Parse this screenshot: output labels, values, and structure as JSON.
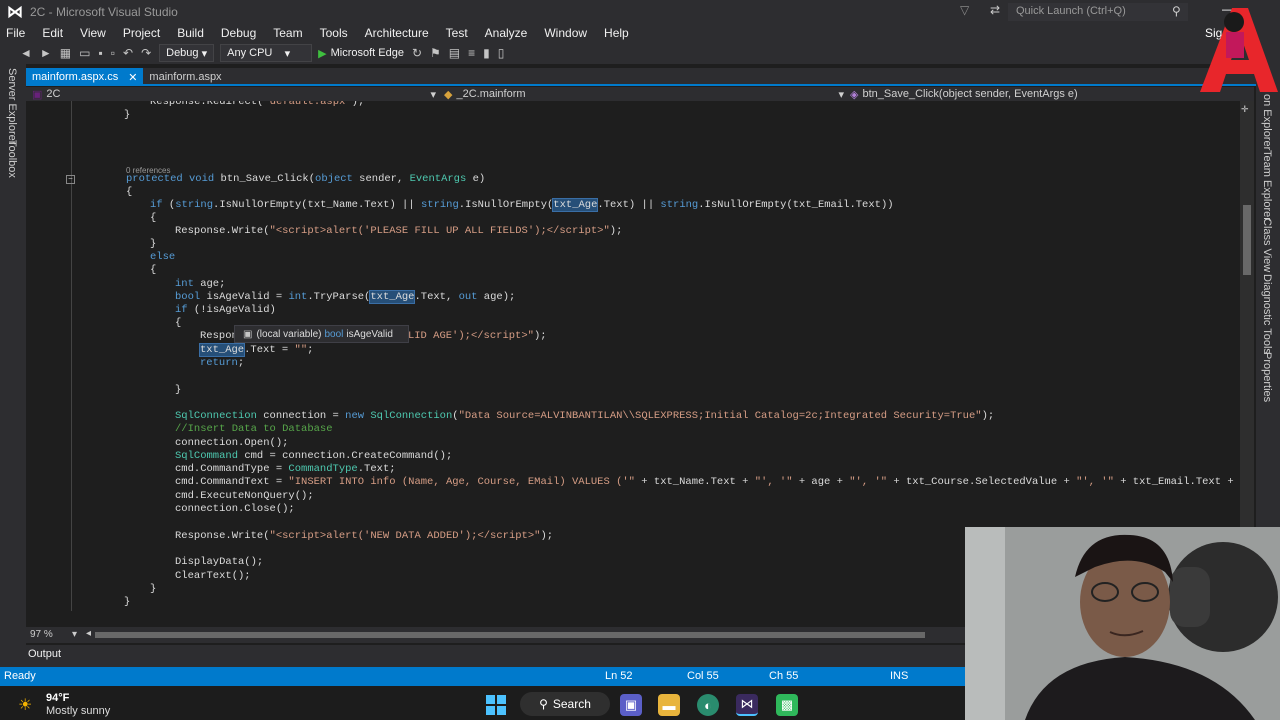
{
  "window": {
    "title": "2C - Microsoft Visual Studio",
    "quick_launch_placeholder": "Quick Launch (Ctrl+Q)",
    "signin": "Sig"
  },
  "menu": [
    "File",
    "Edit",
    "View",
    "Project",
    "Build",
    "Debug",
    "Team",
    "Tools",
    "Architecture",
    "Test",
    "Analyze",
    "Window",
    "Help"
  ],
  "toolbar": {
    "config": "Debug",
    "platform": "Any CPU",
    "run_target": "Microsoft Edge"
  },
  "left_dock": [
    "Server Explorer",
    "Toolbox"
  ],
  "right_dock": [
    "on Explorer",
    "Team Explorer",
    "Class View",
    "Diagnostic Tools",
    "Properties"
  ],
  "tabs": [
    {
      "label": "mainform.aspx.cs",
      "active": true
    },
    {
      "label": "mainform.aspx",
      "active": false
    }
  ],
  "navbar": {
    "project": "2C",
    "class": "_2C.mainform",
    "member": "btn_Save_Click(object sender, EventArgs e)"
  },
  "code": {
    "references": "0 references"
  },
  "tooltip": {
    "prefix": "(local variable)",
    "keyword": "bool",
    "name": "isAgeValid"
  },
  "zoom": "97 %",
  "output_label": "Output",
  "status": {
    "ready": "Ready",
    "ln": "Ln 52",
    "col": "Col 55",
    "ch": "Ch 55",
    "mode": "INS"
  },
  "taskbar": {
    "temp": "94°F",
    "weather": "Mostly sunny",
    "search": "Search"
  }
}
